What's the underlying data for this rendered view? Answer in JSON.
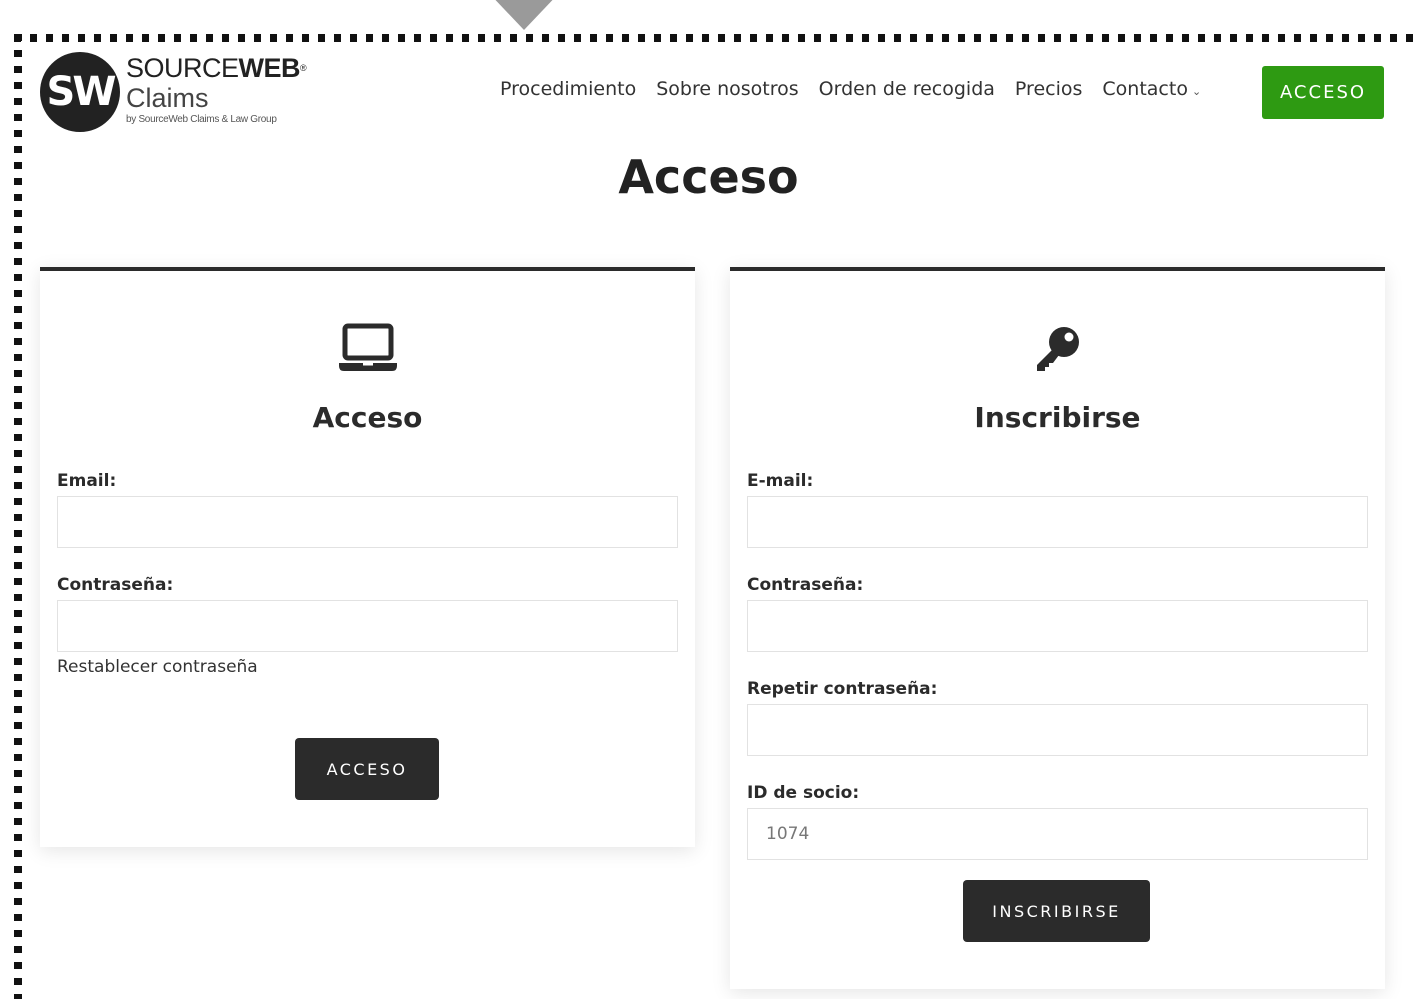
{
  "brand": {
    "logo_mark": "SW",
    "name_regular": "SOURCE",
    "name_bold": "WEB",
    "registered": "®",
    "product": "Claims",
    "tagline": "by SourceWeb Claims & Law Group"
  },
  "nav": {
    "items": [
      {
        "label": "Procedimiento"
      },
      {
        "label": "Sobre nosotros"
      },
      {
        "label": "Orden de recogida"
      },
      {
        "label": "Precios"
      },
      {
        "label": "Contacto",
        "has_dropdown": true
      }
    ],
    "dropdown_glyph": "⌄",
    "cta_label": "ACCESO",
    "cta_color": "#2e9a12"
  },
  "page": {
    "title": "Acceso"
  },
  "login": {
    "icon": "laptop-icon",
    "heading": "Acceso",
    "email_label": "Email:",
    "email_value": "",
    "password_label": "Contraseña:",
    "password_value": "",
    "reset_link": "Restablecer contraseña",
    "submit_label": "ACCESO"
  },
  "register": {
    "icon": "key-icon",
    "heading": "Inscribirse",
    "email_label": "E-mail:",
    "email_value": "",
    "password_label": "Contraseña:",
    "password_value": "",
    "repeat_label": "Repetir contraseña:",
    "repeat_value": "",
    "member_id_label": "ID de socio:",
    "member_id_value": "1074",
    "submit_label": "INSCRIBIRSE"
  }
}
